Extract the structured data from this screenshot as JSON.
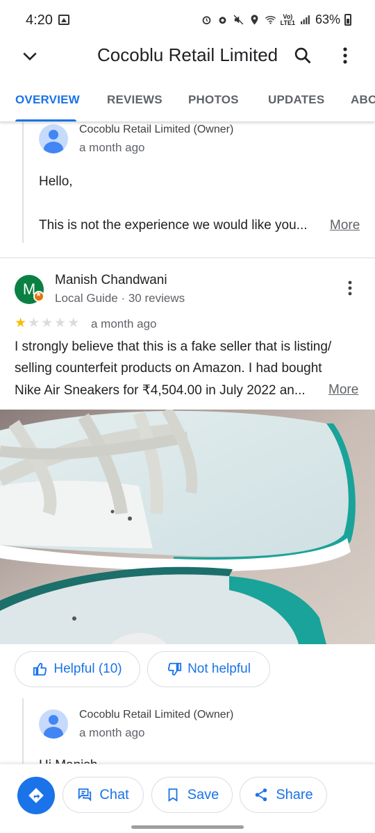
{
  "status_bar": {
    "time": "4:20",
    "lte": "Vo)\nLTE1",
    "battery": "63%"
  },
  "app_bar": {
    "title": "Cocoblu Retail Limited"
  },
  "tabs": [
    {
      "label": "OVERVIEW",
      "active": true
    },
    {
      "label": "REVIEWS",
      "active": false
    },
    {
      "label": "PHOTOS",
      "active": false
    },
    {
      "label": "UPDATES",
      "active": false
    },
    {
      "label": "ABOUT",
      "active": false
    }
  ],
  "owner_reply_1": {
    "name": "Cocoblu Retail Limited (Owner)",
    "time": "a month ago",
    "greeting": "Hello,",
    "text": "This is not the experience we would like you...",
    "more": "More"
  },
  "review": {
    "avatar_letter": "M",
    "avatar_color": "#0b8043",
    "reviewer_name": "Manish Chandwani",
    "reviewer_meta": "Local Guide · 30 reviews",
    "rating": 1,
    "rating_max": 5,
    "time": "a month ago",
    "lines": [
      "I strongly believe that this is a fake seller that is listing/",
      "selling counterfeit products on Amazon. I had bought",
      "Nike Air Sneakers for ₹4,504.00 in July 2022 an..."
    ],
    "more": "More",
    "helpful_label": "Helpful (10)",
    "not_helpful_label": "Not helpful"
  },
  "owner_reply_2": {
    "name": "Cocoblu Retail Limited (Owner)",
    "time": "a month ago",
    "text": "Hi Manish"
  },
  "bottom_bar": {
    "chat_label": "Chat",
    "save_label": "Save",
    "share_label": "Share"
  },
  "colors": {
    "accent": "#1a73e8",
    "star": "#fbbc04",
    "guide_badge": "#e8710a"
  }
}
